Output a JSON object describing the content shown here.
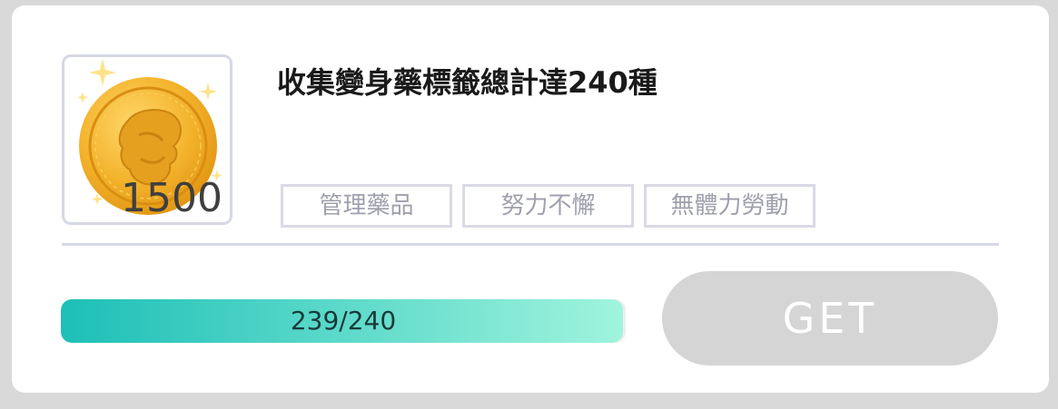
{
  "reward": {
    "icon": "gold-coin-icon",
    "amount": "1500"
  },
  "mission": {
    "title": "收集變身藥標籤總計達240種",
    "tags": [
      "管理藥品",
      "努力不懈",
      "無體力勞動"
    ]
  },
  "progress": {
    "text": "239/240",
    "current": 239,
    "total": 240,
    "fraction": 0.9958
  },
  "action": {
    "label": "GET",
    "enabled": false
  },
  "colors": {
    "coin_gold": "#f2b02a",
    "progress_start": "#1dbfb7",
    "progress_end": "#a0f4dd",
    "button_disabled": "#d5d5d5"
  }
}
